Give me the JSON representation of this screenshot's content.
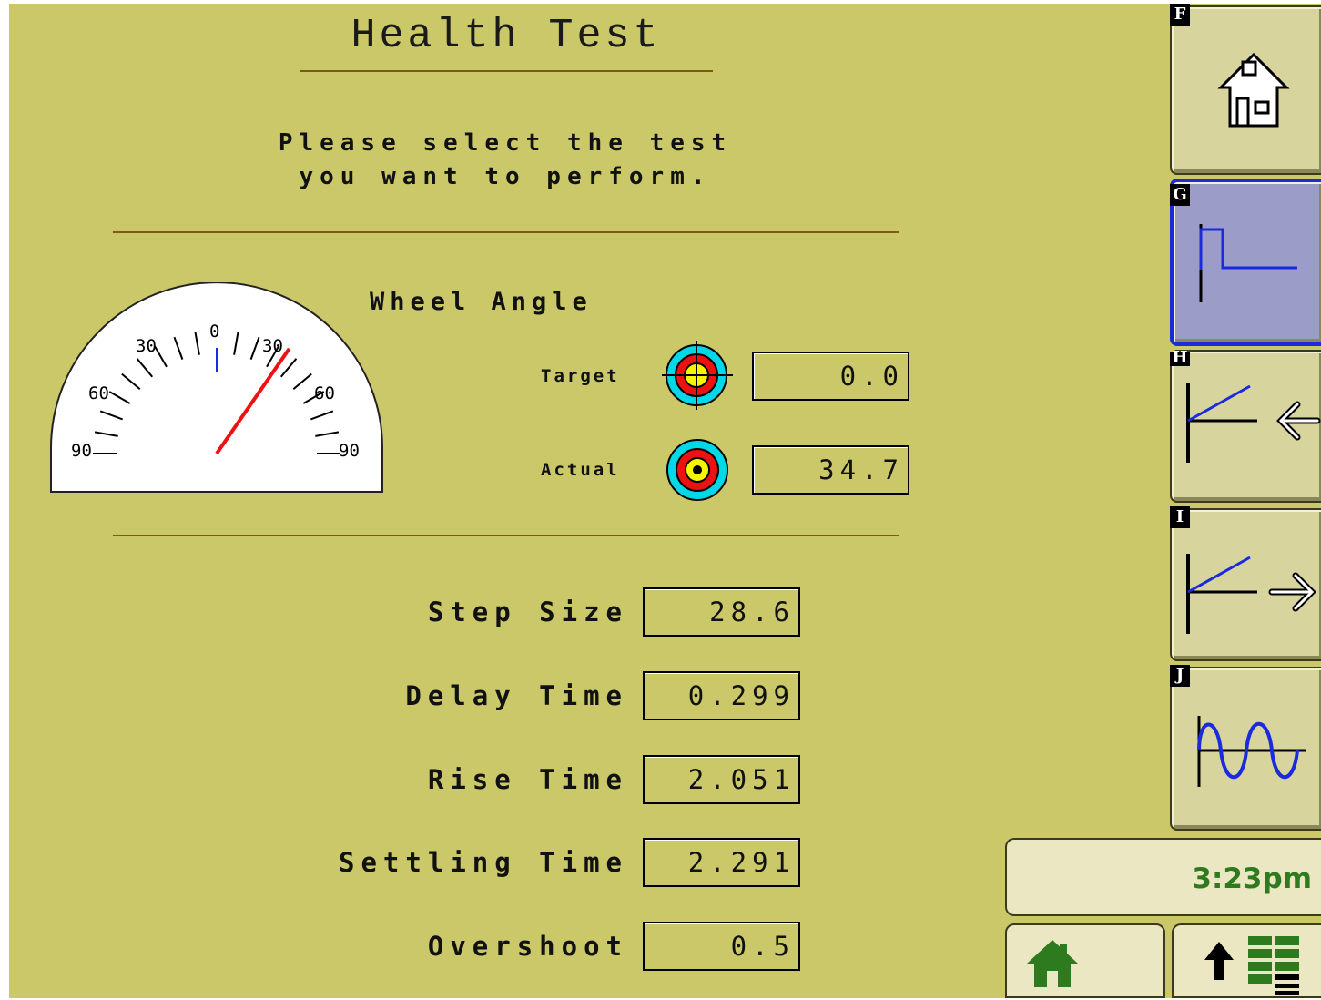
{
  "page": {
    "title": "Health Test",
    "instruction_line1": "Please select the test",
    "instruction_line2": "you want to perform."
  },
  "wheel_angle": {
    "title": "Wheel Angle",
    "gauge_ticks": [
      "0",
      "30",
      "30",
      "60",
      "60",
      "90",
      "90"
    ],
    "needle_deg": 34.7,
    "target_label": "Target",
    "target_value": "0.0",
    "actual_label": "Actual",
    "actual_value": "34.7"
  },
  "metrics": [
    {
      "label": "Step Size",
      "value": "28.6"
    },
    {
      "label": "Delay Time",
      "value": "0.299"
    },
    {
      "label": "Rise Time",
      "value": "2.051"
    },
    {
      "label": "Settling Time",
      "value": "2.291"
    },
    {
      "label": "Overshoot",
      "value": "0.5"
    }
  ],
  "softkeys": [
    {
      "letter": "F",
      "icon": "home-icon"
    },
    {
      "letter": "G",
      "icon": "step-response-icon",
      "selected": true
    },
    {
      "letter": "H",
      "icon": "left-turn-test-icon"
    },
    {
      "letter": "I",
      "icon": "right-turn-test-icon"
    },
    {
      "letter": "J",
      "icon": "sine-wave-icon"
    }
  ],
  "clock": "3:23pm",
  "bottom_buttons": {
    "home_icon": "home-icon",
    "menu_icon": "up-arrow-menu-icon"
  },
  "colors": {
    "background": "#cac869",
    "selected_key": "#9c9cc8",
    "selected_border": "#1a2adf",
    "clock_text": "#2d7a1f",
    "needle": "#ee1111"
  }
}
